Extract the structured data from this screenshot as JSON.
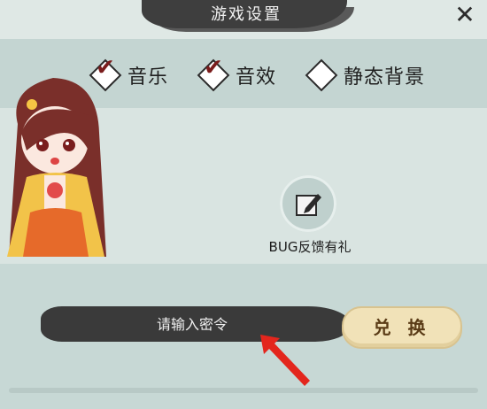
{
  "dialog": {
    "title": "游戏设置"
  },
  "options": [
    {
      "label": "音乐",
      "checked": true
    },
    {
      "label": "音效",
      "checked": true
    },
    {
      "label": "静态背景",
      "checked": false
    }
  ],
  "bug_report": {
    "label": "BUG反馈有礼"
  },
  "redeem": {
    "placeholder": "请输入密令",
    "button_label": "兑 换"
  },
  "icons": {
    "close": "close-icon",
    "bug": "edit-icon",
    "arrow": "pointer-arrow-icon"
  },
  "colors": {
    "brush": "#3a3a3a",
    "button": "#f1e2b8",
    "arrow": "#e3261d"
  }
}
